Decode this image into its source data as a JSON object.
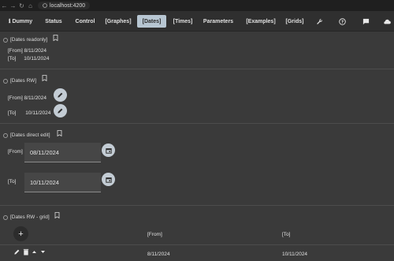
{
  "browser": {
    "url": "localhost:4200"
  },
  "nav": {
    "items": [
      {
        "label": "ℹ Dummy"
      },
      {
        "label": "Status"
      },
      {
        "label": "Control"
      },
      {
        "label": "[Graphes]"
      },
      {
        "label": "[Dates]"
      },
      {
        "label": "[Times]"
      },
      {
        "label": "Parameters"
      },
      {
        "label": "[Examples]"
      },
      {
        "label": "[Grids]"
      }
    ],
    "active": "[Dates]",
    "icons": [
      "wrench-icon",
      "help-icon",
      "chat-icon",
      "cloud-icon"
    ]
  },
  "sections": {
    "readonly": {
      "title": "[Dates readonly]",
      "from_label": "[From]",
      "from_value": "8/11/2024",
      "to_label": "[To]",
      "to_value": "10/11/2024"
    },
    "rw": {
      "title": "[Dates RW]",
      "from_label": "[From]",
      "from_value": "8/11/2024",
      "to_label": "[To]",
      "to_value": "10/11/2024"
    },
    "direct": {
      "title": "[Dates direct edit]",
      "from_label": "[From]",
      "from_value": "08/11/2024",
      "to_label": "[To]",
      "to_value": "10/11/2024"
    },
    "grid": {
      "title": "[Dates RW - grid]",
      "columns": [
        "[From]",
        "[To]"
      ],
      "rows": [
        {
          "from": "8/11/2024",
          "to": "10/11/2024"
        }
      ]
    }
  },
  "colors": {
    "accent_tab": "#b7c6d2",
    "fab": "#c3ccd4",
    "background": "#3a3a3a"
  }
}
